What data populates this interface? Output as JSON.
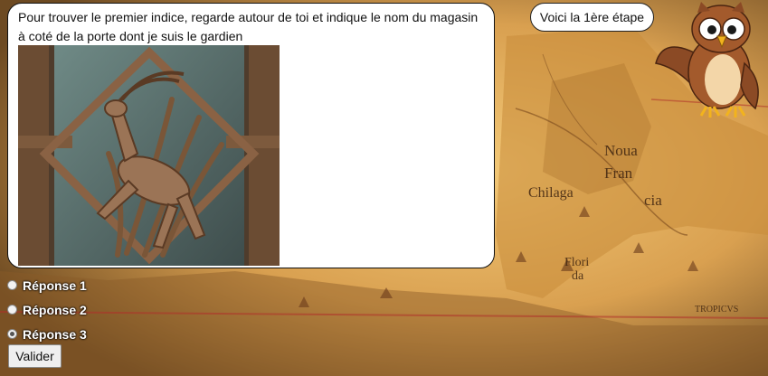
{
  "bubble": {
    "text": "Pour trouver le premier indice, regarde autour de toi et indique le nom du magasin à coté de la porte dont je suis le gardien",
    "image_icon": "antelope-relief-image"
  },
  "step_button": {
    "label": "Voici la 1ère étape"
  },
  "mascot": {
    "icon": "owl-icon"
  },
  "answers": [
    {
      "label": "Réponse 1",
      "selected": false
    },
    {
      "label": "Réponse 2",
      "selected": false
    },
    {
      "label": "Réponse 3",
      "selected": true
    }
  ],
  "validate_button": {
    "label": "Valider"
  },
  "map": {
    "labels": [
      "Noua",
      "Fran",
      "cia",
      "Chilaga",
      "Flori",
      "da",
      "TROPICVS"
    ]
  },
  "colors": {
    "parchment": "#e8b25a",
    "sea": "#c99a55",
    "bubble_bg": "#ffffff"
  }
}
